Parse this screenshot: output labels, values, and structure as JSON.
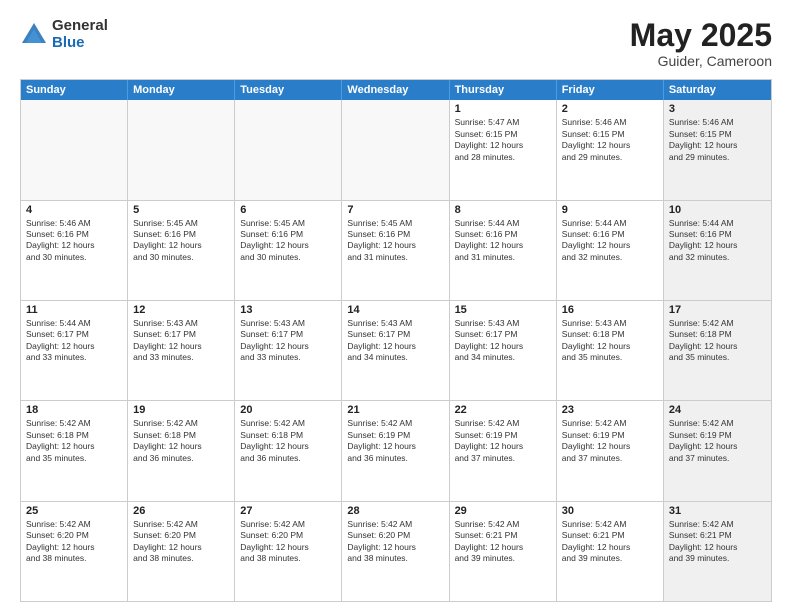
{
  "logo": {
    "general": "General",
    "blue": "Blue"
  },
  "title": {
    "month": "May 2025",
    "location": "Guider, Cameroon"
  },
  "days": [
    "Sunday",
    "Monday",
    "Tuesday",
    "Wednesday",
    "Thursday",
    "Friday",
    "Saturday"
  ],
  "rows": [
    [
      {
        "day": "",
        "text": "",
        "empty": true
      },
      {
        "day": "",
        "text": "",
        "empty": true
      },
      {
        "day": "",
        "text": "",
        "empty": true
      },
      {
        "day": "",
        "text": "",
        "empty": true
      },
      {
        "day": "1",
        "text": "Sunrise: 5:47 AM\nSunset: 6:15 PM\nDaylight: 12 hours\nand 28 minutes."
      },
      {
        "day": "2",
        "text": "Sunrise: 5:46 AM\nSunset: 6:15 PM\nDaylight: 12 hours\nand 29 minutes."
      },
      {
        "day": "3",
        "text": "Sunrise: 5:46 AM\nSunset: 6:15 PM\nDaylight: 12 hours\nand 29 minutes.",
        "shaded": true
      }
    ],
    [
      {
        "day": "4",
        "text": "Sunrise: 5:46 AM\nSunset: 6:16 PM\nDaylight: 12 hours\nand 30 minutes."
      },
      {
        "day": "5",
        "text": "Sunrise: 5:45 AM\nSunset: 6:16 PM\nDaylight: 12 hours\nand 30 minutes."
      },
      {
        "day": "6",
        "text": "Sunrise: 5:45 AM\nSunset: 6:16 PM\nDaylight: 12 hours\nand 30 minutes."
      },
      {
        "day": "7",
        "text": "Sunrise: 5:45 AM\nSunset: 6:16 PM\nDaylight: 12 hours\nand 31 minutes."
      },
      {
        "day": "8",
        "text": "Sunrise: 5:44 AM\nSunset: 6:16 PM\nDaylight: 12 hours\nand 31 minutes."
      },
      {
        "day": "9",
        "text": "Sunrise: 5:44 AM\nSunset: 6:16 PM\nDaylight: 12 hours\nand 32 minutes."
      },
      {
        "day": "10",
        "text": "Sunrise: 5:44 AM\nSunset: 6:16 PM\nDaylight: 12 hours\nand 32 minutes.",
        "shaded": true
      }
    ],
    [
      {
        "day": "11",
        "text": "Sunrise: 5:44 AM\nSunset: 6:17 PM\nDaylight: 12 hours\nand 33 minutes."
      },
      {
        "day": "12",
        "text": "Sunrise: 5:43 AM\nSunset: 6:17 PM\nDaylight: 12 hours\nand 33 minutes."
      },
      {
        "day": "13",
        "text": "Sunrise: 5:43 AM\nSunset: 6:17 PM\nDaylight: 12 hours\nand 33 minutes."
      },
      {
        "day": "14",
        "text": "Sunrise: 5:43 AM\nSunset: 6:17 PM\nDaylight: 12 hours\nand 34 minutes."
      },
      {
        "day": "15",
        "text": "Sunrise: 5:43 AM\nSunset: 6:17 PM\nDaylight: 12 hours\nand 34 minutes."
      },
      {
        "day": "16",
        "text": "Sunrise: 5:43 AM\nSunset: 6:18 PM\nDaylight: 12 hours\nand 35 minutes."
      },
      {
        "day": "17",
        "text": "Sunrise: 5:42 AM\nSunset: 6:18 PM\nDaylight: 12 hours\nand 35 minutes.",
        "shaded": true
      }
    ],
    [
      {
        "day": "18",
        "text": "Sunrise: 5:42 AM\nSunset: 6:18 PM\nDaylight: 12 hours\nand 35 minutes."
      },
      {
        "day": "19",
        "text": "Sunrise: 5:42 AM\nSunset: 6:18 PM\nDaylight: 12 hours\nand 36 minutes."
      },
      {
        "day": "20",
        "text": "Sunrise: 5:42 AM\nSunset: 6:18 PM\nDaylight: 12 hours\nand 36 minutes."
      },
      {
        "day": "21",
        "text": "Sunrise: 5:42 AM\nSunset: 6:19 PM\nDaylight: 12 hours\nand 36 minutes."
      },
      {
        "day": "22",
        "text": "Sunrise: 5:42 AM\nSunset: 6:19 PM\nDaylight: 12 hours\nand 37 minutes."
      },
      {
        "day": "23",
        "text": "Sunrise: 5:42 AM\nSunset: 6:19 PM\nDaylight: 12 hours\nand 37 minutes."
      },
      {
        "day": "24",
        "text": "Sunrise: 5:42 AM\nSunset: 6:19 PM\nDaylight: 12 hours\nand 37 minutes.",
        "shaded": true
      }
    ],
    [
      {
        "day": "25",
        "text": "Sunrise: 5:42 AM\nSunset: 6:20 PM\nDaylight: 12 hours\nand 38 minutes."
      },
      {
        "day": "26",
        "text": "Sunrise: 5:42 AM\nSunset: 6:20 PM\nDaylight: 12 hours\nand 38 minutes."
      },
      {
        "day": "27",
        "text": "Sunrise: 5:42 AM\nSunset: 6:20 PM\nDaylight: 12 hours\nand 38 minutes."
      },
      {
        "day": "28",
        "text": "Sunrise: 5:42 AM\nSunset: 6:20 PM\nDaylight: 12 hours\nand 38 minutes."
      },
      {
        "day": "29",
        "text": "Sunrise: 5:42 AM\nSunset: 6:21 PM\nDaylight: 12 hours\nand 39 minutes."
      },
      {
        "day": "30",
        "text": "Sunrise: 5:42 AM\nSunset: 6:21 PM\nDaylight: 12 hours\nand 39 minutes."
      },
      {
        "day": "31",
        "text": "Sunrise: 5:42 AM\nSunset: 6:21 PM\nDaylight: 12 hours\nand 39 minutes.",
        "shaded": true
      }
    ]
  ]
}
